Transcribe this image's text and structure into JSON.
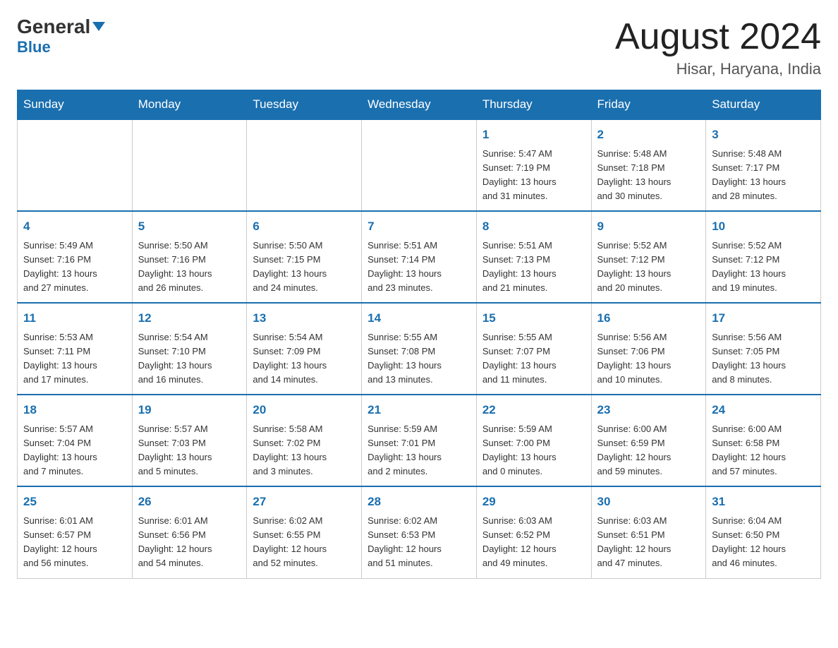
{
  "header": {
    "logo_general": "General",
    "logo_blue": "Blue",
    "month_year": "August 2024",
    "location": "Hisar, Haryana, India"
  },
  "days_of_week": [
    "Sunday",
    "Monday",
    "Tuesday",
    "Wednesday",
    "Thursday",
    "Friday",
    "Saturday"
  ],
  "weeks": [
    [
      {
        "day": "",
        "info": ""
      },
      {
        "day": "",
        "info": ""
      },
      {
        "day": "",
        "info": ""
      },
      {
        "day": "",
        "info": ""
      },
      {
        "day": "1",
        "info": "Sunrise: 5:47 AM\nSunset: 7:19 PM\nDaylight: 13 hours\nand 31 minutes."
      },
      {
        "day": "2",
        "info": "Sunrise: 5:48 AM\nSunset: 7:18 PM\nDaylight: 13 hours\nand 30 minutes."
      },
      {
        "day": "3",
        "info": "Sunrise: 5:48 AM\nSunset: 7:17 PM\nDaylight: 13 hours\nand 28 minutes."
      }
    ],
    [
      {
        "day": "4",
        "info": "Sunrise: 5:49 AM\nSunset: 7:16 PM\nDaylight: 13 hours\nand 27 minutes."
      },
      {
        "day": "5",
        "info": "Sunrise: 5:50 AM\nSunset: 7:16 PM\nDaylight: 13 hours\nand 26 minutes."
      },
      {
        "day": "6",
        "info": "Sunrise: 5:50 AM\nSunset: 7:15 PM\nDaylight: 13 hours\nand 24 minutes."
      },
      {
        "day": "7",
        "info": "Sunrise: 5:51 AM\nSunset: 7:14 PM\nDaylight: 13 hours\nand 23 minutes."
      },
      {
        "day": "8",
        "info": "Sunrise: 5:51 AM\nSunset: 7:13 PM\nDaylight: 13 hours\nand 21 minutes."
      },
      {
        "day": "9",
        "info": "Sunrise: 5:52 AM\nSunset: 7:12 PM\nDaylight: 13 hours\nand 20 minutes."
      },
      {
        "day": "10",
        "info": "Sunrise: 5:52 AM\nSunset: 7:12 PM\nDaylight: 13 hours\nand 19 minutes."
      }
    ],
    [
      {
        "day": "11",
        "info": "Sunrise: 5:53 AM\nSunset: 7:11 PM\nDaylight: 13 hours\nand 17 minutes."
      },
      {
        "day": "12",
        "info": "Sunrise: 5:54 AM\nSunset: 7:10 PM\nDaylight: 13 hours\nand 16 minutes."
      },
      {
        "day": "13",
        "info": "Sunrise: 5:54 AM\nSunset: 7:09 PM\nDaylight: 13 hours\nand 14 minutes."
      },
      {
        "day": "14",
        "info": "Sunrise: 5:55 AM\nSunset: 7:08 PM\nDaylight: 13 hours\nand 13 minutes."
      },
      {
        "day": "15",
        "info": "Sunrise: 5:55 AM\nSunset: 7:07 PM\nDaylight: 13 hours\nand 11 minutes."
      },
      {
        "day": "16",
        "info": "Sunrise: 5:56 AM\nSunset: 7:06 PM\nDaylight: 13 hours\nand 10 minutes."
      },
      {
        "day": "17",
        "info": "Sunrise: 5:56 AM\nSunset: 7:05 PM\nDaylight: 13 hours\nand 8 minutes."
      }
    ],
    [
      {
        "day": "18",
        "info": "Sunrise: 5:57 AM\nSunset: 7:04 PM\nDaylight: 13 hours\nand 7 minutes."
      },
      {
        "day": "19",
        "info": "Sunrise: 5:57 AM\nSunset: 7:03 PM\nDaylight: 13 hours\nand 5 minutes."
      },
      {
        "day": "20",
        "info": "Sunrise: 5:58 AM\nSunset: 7:02 PM\nDaylight: 13 hours\nand 3 minutes."
      },
      {
        "day": "21",
        "info": "Sunrise: 5:59 AM\nSunset: 7:01 PM\nDaylight: 13 hours\nand 2 minutes."
      },
      {
        "day": "22",
        "info": "Sunrise: 5:59 AM\nSunset: 7:00 PM\nDaylight: 13 hours\nand 0 minutes."
      },
      {
        "day": "23",
        "info": "Sunrise: 6:00 AM\nSunset: 6:59 PM\nDaylight: 12 hours\nand 59 minutes."
      },
      {
        "day": "24",
        "info": "Sunrise: 6:00 AM\nSunset: 6:58 PM\nDaylight: 12 hours\nand 57 minutes."
      }
    ],
    [
      {
        "day": "25",
        "info": "Sunrise: 6:01 AM\nSunset: 6:57 PM\nDaylight: 12 hours\nand 56 minutes."
      },
      {
        "day": "26",
        "info": "Sunrise: 6:01 AM\nSunset: 6:56 PM\nDaylight: 12 hours\nand 54 minutes."
      },
      {
        "day": "27",
        "info": "Sunrise: 6:02 AM\nSunset: 6:55 PM\nDaylight: 12 hours\nand 52 minutes."
      },
      {
        "day": "28",
        "info": "Sunrise: 6:02 AM\nSunset: 6:53 PM\nDaylight: 12 hours\nand 51 minutes."
      },
      {
        "day": "29",
        "info": "Sunrise: 6:03 AM\nSunset: 6:52 PM\nDaylight: 12 hours\nand 49 minutes."
      },
      {
        "day": "30",
        "info": "Sunrise: 6:03 AM\nSunset: 6:51 PM\nDaylight: 12 hours\nand 47 minutes."
      },
      {
        "day": "31",
        "info": "Sunrise: 6:04 AM\nSunset: 6:50 PM\nDaylight: 12 hours\nand 46 minutes."
      }
    ]
  ]
}
